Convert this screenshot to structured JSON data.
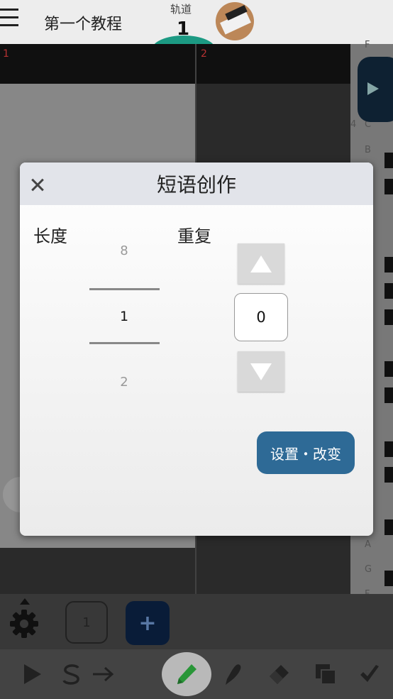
{
  "header": {
    "title": "第一个教程",
    "track_label": "轨道",
    "track_number": "1"
  },
  "editor": {
    "measures": [
      "1",
      "2"
    ]
  },
  "piano": {
    "labels": [
      {
        "text": "F",
        "octave": ""
      },
      {
        "text": "C",
        "octave": "4"
      },
      {
        "text": "B",
        "octave": ""
      },
      {
        "text": "A",
        "octave": ""
      },
      {
        "text": "G",
        "octave": ""
      },
      {
        "text": "F",
        "octave": ""
      }
    ]
  },
  "controls": {
    "phrase_label": "1",
    "add_symbol": "+"
  },
  "dialog": {
    "title": "短语创作",
    "close_symbol": "×",
    "length_label": "长度",
    "repeat_label": "重复",
    "length_picker": {
      "prev": "8",
      "selected": "1",
      "next": "2"
    },
    "repeat_value": "0",
    "apply_button": "设置・改变"
  },
  "colors": {
    "apply_button": "#2e6a96",
    "dialog_header": "#e2e4ea",
    "track_indicator": "#1d9e86",
    "measure_number": "#b33333",
    "edit_tool_active": "#2a9a3a"
  },
  "icons": {
    "menu": "hamburger-icon",
    "settings": "gear-icon",
    "play": "play-icon",
    "solo": "s-icon",
    "arrow": "arrow-right-icon",
    "edit": "pencil-icon",
    "select": "lasso-icon",
    "erase": "eraser-icon",
    "copy": "copy-icon",
    "paste": "brush-icon"
  }
}
